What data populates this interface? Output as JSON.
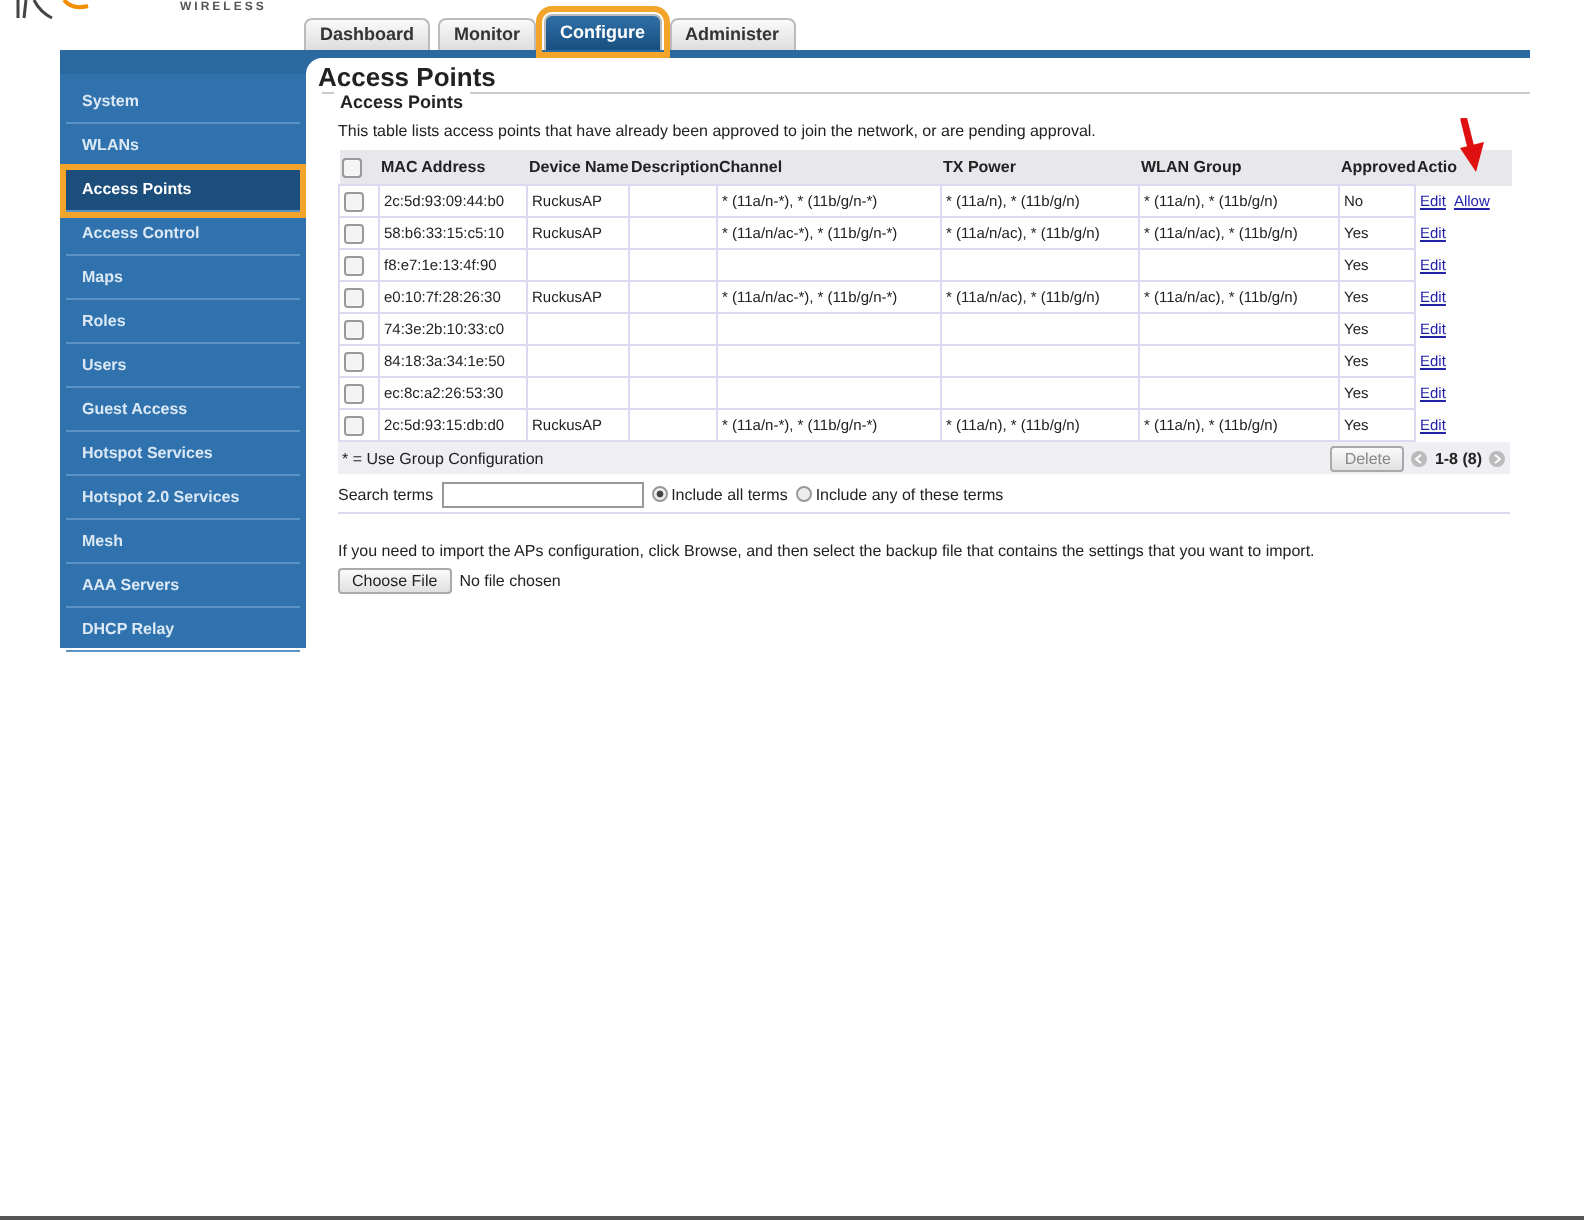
{
  "logo": {
    "tagline": "WIRELESS"
  },
  "tabs": [
    {
      "label": "Dashboard",
      "selected": false
    },
    {
      "label": "Monitor",
      "selected": false
    },
    {
      "label": "Configure",
      "selected": true
    },
    {
      "label": "Administer",
      "selected": false
    }
  ],
  "sidebar": {
    "items": [
      {
        "label": "System",
        "selected": false
      },
      {
        "label": "WLANs",
        "selected": false
      },
      {
        "label": "Access Points",
        "selected": true
      },
      {
        "label": "Access Control",
        "selected": false
      },
      {
        "label": "Maps",
        "selected": false
      },
      {
        "label": "Roles",
        "selected": false
      },
      {
        "label": "Users",
        "selected": false
      },
      {
        "label": "Guest Access",
        "selected": false
      },
      {
        "label": "Hotspot Services",
        "selected": false
      },
      {
        "label": "Hotspot 2.0 Services",
        "selected": false
      },
      {
        "label": "Mesh",
        "selected": false
      },
      {
        "label": "AAA Servers",
        "selected": false
      },
      {
        "label": "DHCP Relay",
        "selected": false
      }
    ]
  },
  "page_title": "Access Points",
  "section": {
    "title": "Access Points",
    "description": "This table lists access points that have already been approved to join the network, or are pending approval.",
    "table": {
      "select_all_checked": false,
      "columns": [
        "MAC Address",
        "Device Name",
        "Description",
        "Channel",
        "TX Power",
        "WLAN Group",
        "Approved",
        "Actio"
      ],
      "rows": [
        {
          "checked": false,
          "mac": "2c:5d:93:09:44:b0",
          "device_name": "RuckusAP",
          "channel": "* (11a/n-*), * (11b/g/n-*)",
          "tx_power": "* (11a/n), * (11b/g/n)",
          "wlan_group": "* (11a/n), * (11b/g/n)",
          "approved": "No",
          "actions": [
            "Edit",
            "Allow"
          ]
        },
        {
          "checked": false,
          "mac": "58:b6:33:15:c5:10",
          "device_name": "RuckusAP",
          "channel": "* (11a/n/ac-*), * (11b/g/n-*)",
          "tx_power": "* (11a/n/ac), * (11b/g/n)",
          "wlan_group": "* (11a/n/ac), * (11b/g/n)",
          "approved": "Yes",
          "actions": [
            "Edit"
          ]
        },
        {
          "checked": false,
          "mac": "f8:e7:1e:13:4f:90",
          "approved": "Yes",
          "actions": [
            "Edit"
          ]
        },
        {
          "checked": false,
          "mac": "e0:10:7f:28:26:30",
          "device_name": "RuckusAP",
          "channel": "* (11a/n/ac-*), * (11b/g/n-*)",
          "tx_power": "* (11a/n/ac), * (11b/g/n)",
          "wlan_group": "* (11a/n/ac), * (11b/g/n)",
          "approved": "Yes",
          "actions": [
            "Edit"
          ]
        },
        {
          "checked": false,
          "mac": "74:3e:2b:10:33:c0",
          "approved": "Yes",
          "actions": [
            "Edit"
          ]
        },
        {
          "checked": false,
          "mac": "84:18:3a:34:1e:50",
          "approved": "Yes",
          "actions": [
            "Edit"
          ]
        },
        {
          "checked": false,
          "mac": "ec:8c:a2:26:53:30",
          "approved": "Yes",
          "actions": [
            "Edit"
          ]
        },
        {
          "checked": false,
          "mac": "2c:5d:93:15:db:d0",
          "device_name": "RuckusAP",
          "channel": "* (11a/n-*), * (11b/g/n-*)",
          "tx_power": "* (11a/n), * (11b/g/n)",
          "wlan_group": "* (11a/n), * (11b/g/n)",
          "approved": "Yes",
          "actions": [
            "Edit"
          ]
        }
      ]
    },
    "footnote": "* = Use Group Configuration",
    "delete_button": {
      "label": "Delete",
      "disabled": true
    },
    "pagination": "1-8 (8)",
    "search": {
      "label": "Search terms",
      "options": [
        {
          "label": "Include all terms",
          "selected": true
        },
        {
          "label": "Include any of these terms",
          "selected": false
        }
      ]
    },
    "import": {
      "text": "If you need to import the APs configuration, click Browse, and then select the backup file that contains the settings that you want to import.",
      "button": "Choose File",
      "status": "No file chosen"
    }
  }
}
